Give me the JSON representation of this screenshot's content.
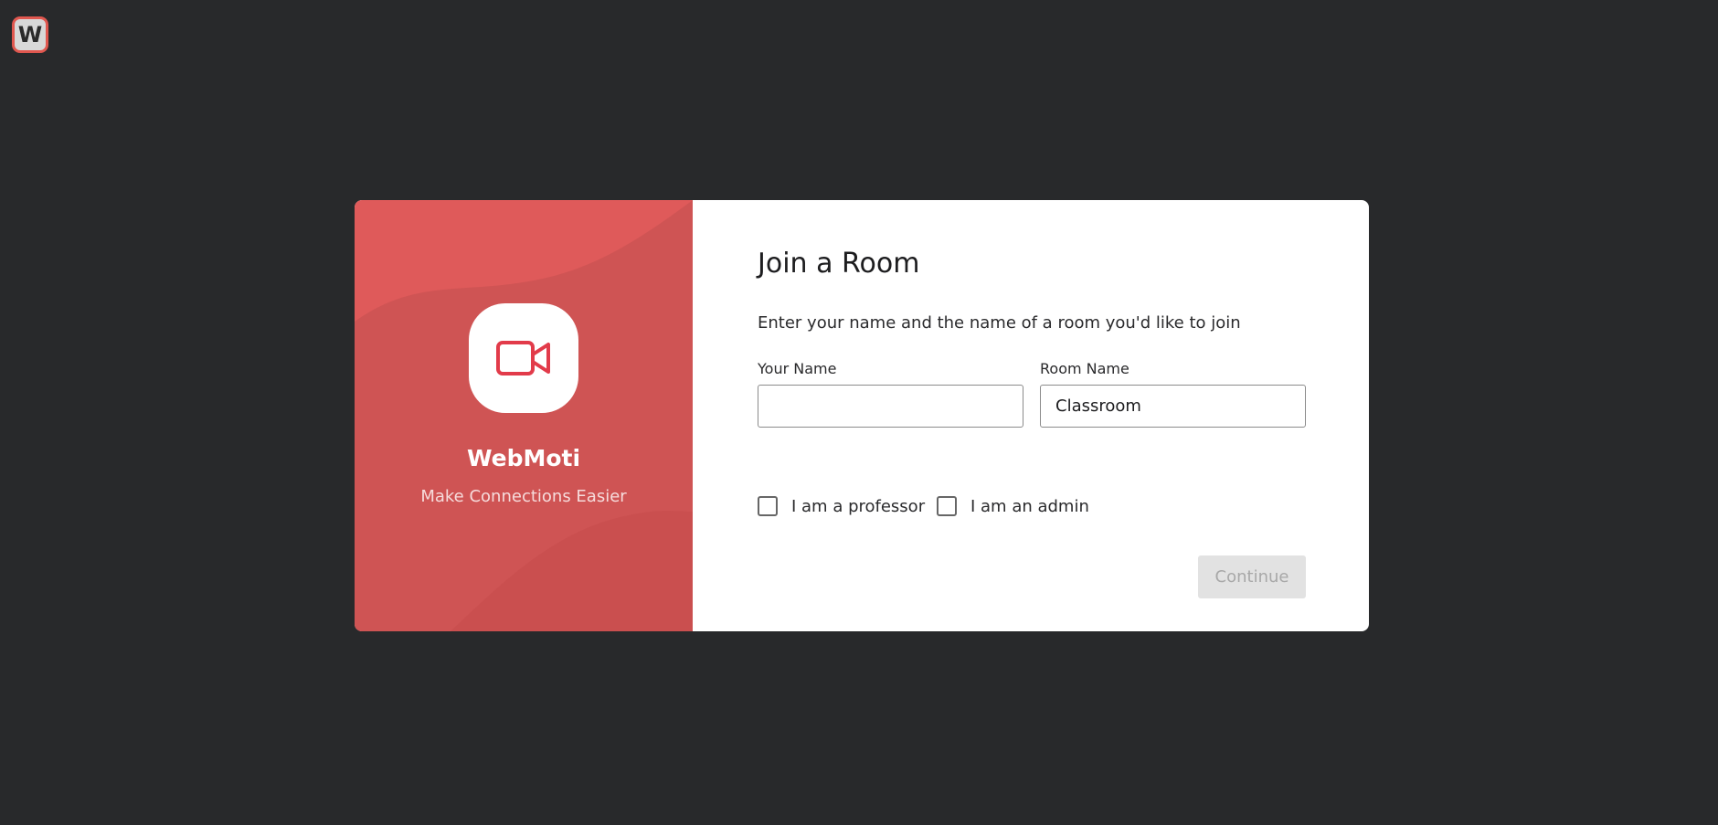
{
  "app": {
    "logo_letter": "W"
  },
  "brand": {
    "name": "WebMoti",
    "tagline": "Make Connections Easier",
    "icon": "video-camera-icon",
    "panel_color": "#df5a5a",
    "icon_color": "#e23b4a"
  },
  "form": {
    "title": "Join a Room",
    "subtitle": "Enter your name and the name of a room you'd like to join",
    "your_name": {
      "label": "Your Name",
      "value": "",
      "placeholder": ""
    },
    "room_name": {
      "label": "Room Name",
      "value": "Classroom"
    },
    "checkboxes": [
      {
        "label": "I am a professor",
        "checked": false
      },
      {
        "label": "I am an admin",
        "checked": false
      }
    ],
    "continue_label": "Continue"
  }
}
